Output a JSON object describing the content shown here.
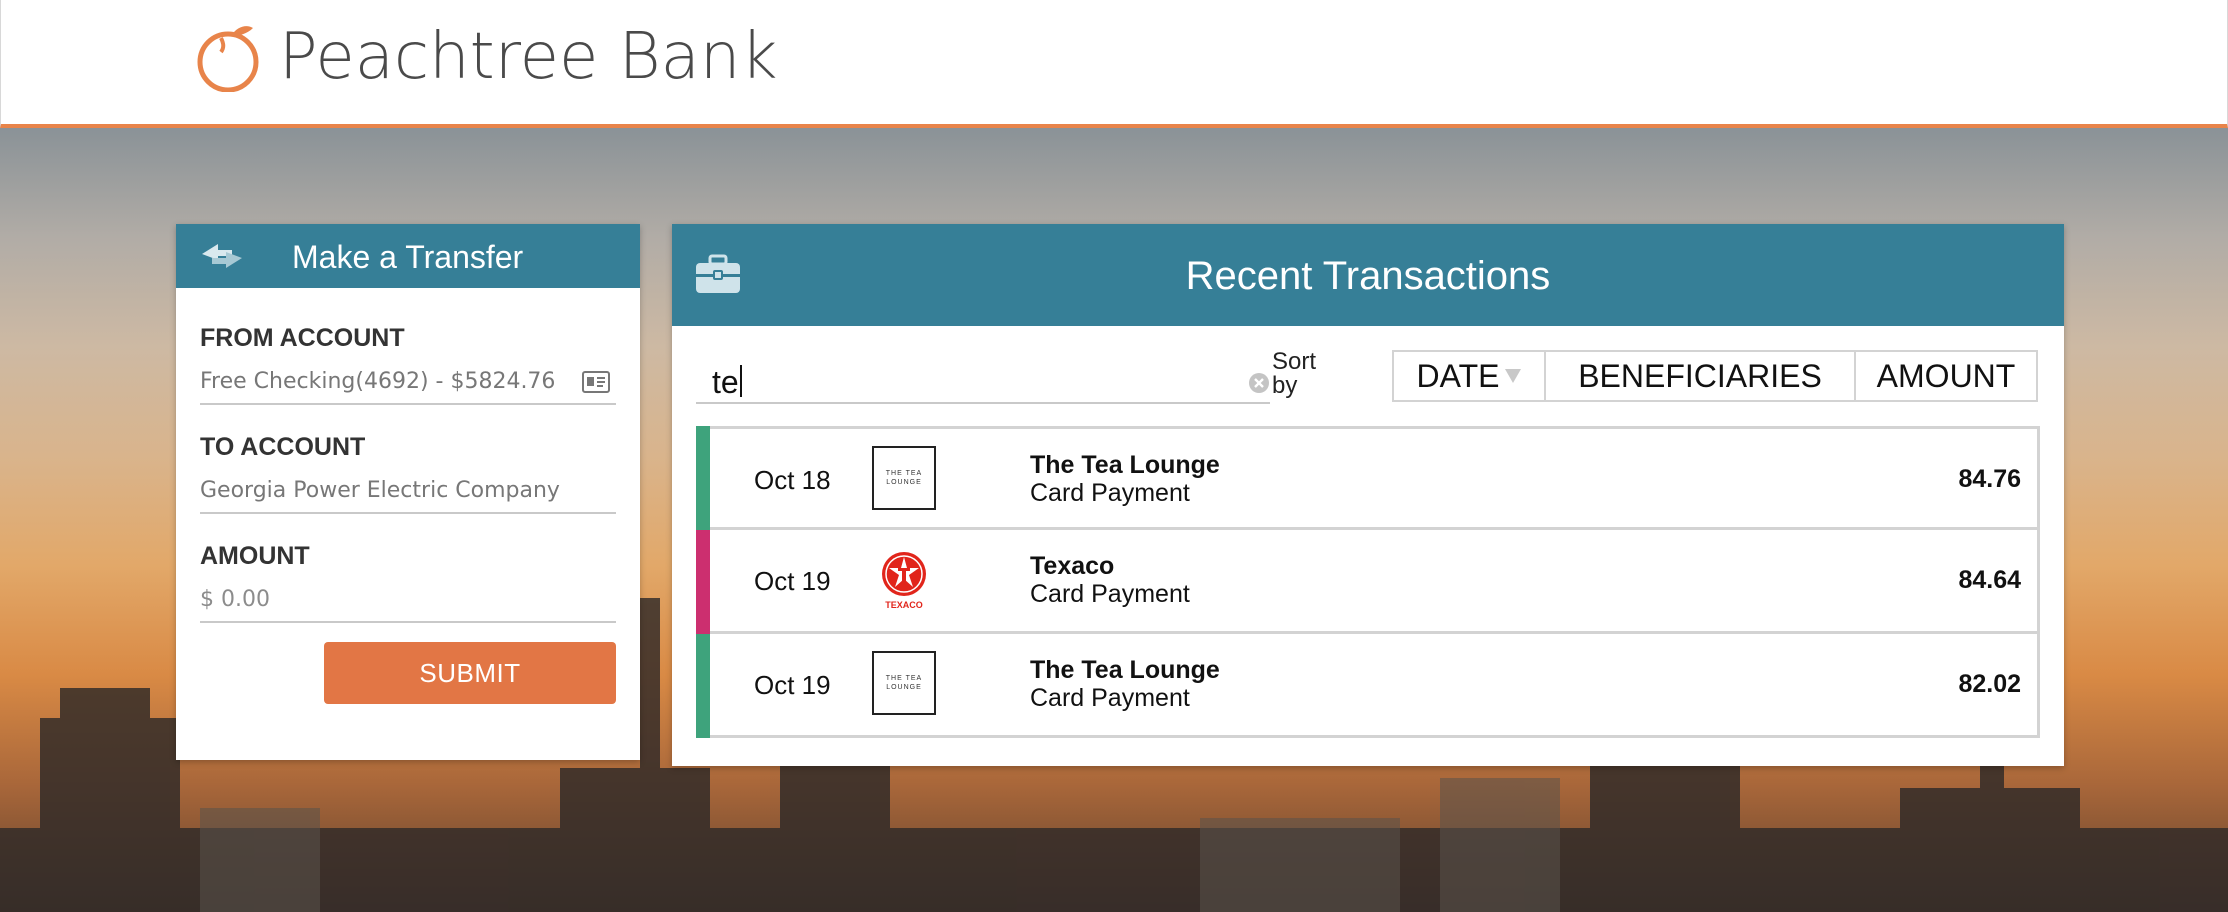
{
  "header": {
    "brand": "Peachtree Bank",
    "logo_icon": "peach-icon",
    "accent_color": "#e8844a"
  },
  "transfer": {
    "title": "Make a Transfer",
    "icon": "transfer-arrows-icon",
    "from_label": "FROM ACCOUNT",
    "from_value": "Free Checking(4692) - $5824.76",
    "to_label": "TO ACCOUNT",
    "to_value": "Georgia Power Electric Company",
    "amount_label": "AMOUNT",
    "amount_placeholder": "$ 0.00",
    "submit_label": "SUBMIT",
    "header_color": "#367f97",
    "submit_color": "#e27645"
  },
  "transactions": {
    "title": "Recent Transactions",
    "icon": "briefcase-icon",
    "search_value": "te",
    "sort_label": "Sort by",
    "sort_options": [
      "DATE",
      "BENEFICIARIES",
      "AMOUNT"
    ],
    "rows": [
      {
        "date": "Oct 18",
        "merchant": "The Tea Lounge",
        "type": "Card Payment",
        "amount": "84.76",
        "color": "#3ea37c",
        "logo": "tea-lounge-logo"
      },
      {
        "date": "Oct 19",
        "merchant": "Texaco",
        "type": "Card Payment",
        "amount": "84.64",
        "color": "#cc2f6f",
        "logo": "texaco-logo"
      },
      {
        "date": "Oct 19",
        "merchant": "The Tea Lounge",
        "type": "Card Payment",
        "amount": "82.02",
        "color": "#3ea37c",
        "logo": "tea-lounge-logo"
      }
    ],
    "tea_logo_text": [
      "THE TEA",
      "LOUNGE"
    ],
    "texaco_logo_text": "TEXACO"
  }
}
